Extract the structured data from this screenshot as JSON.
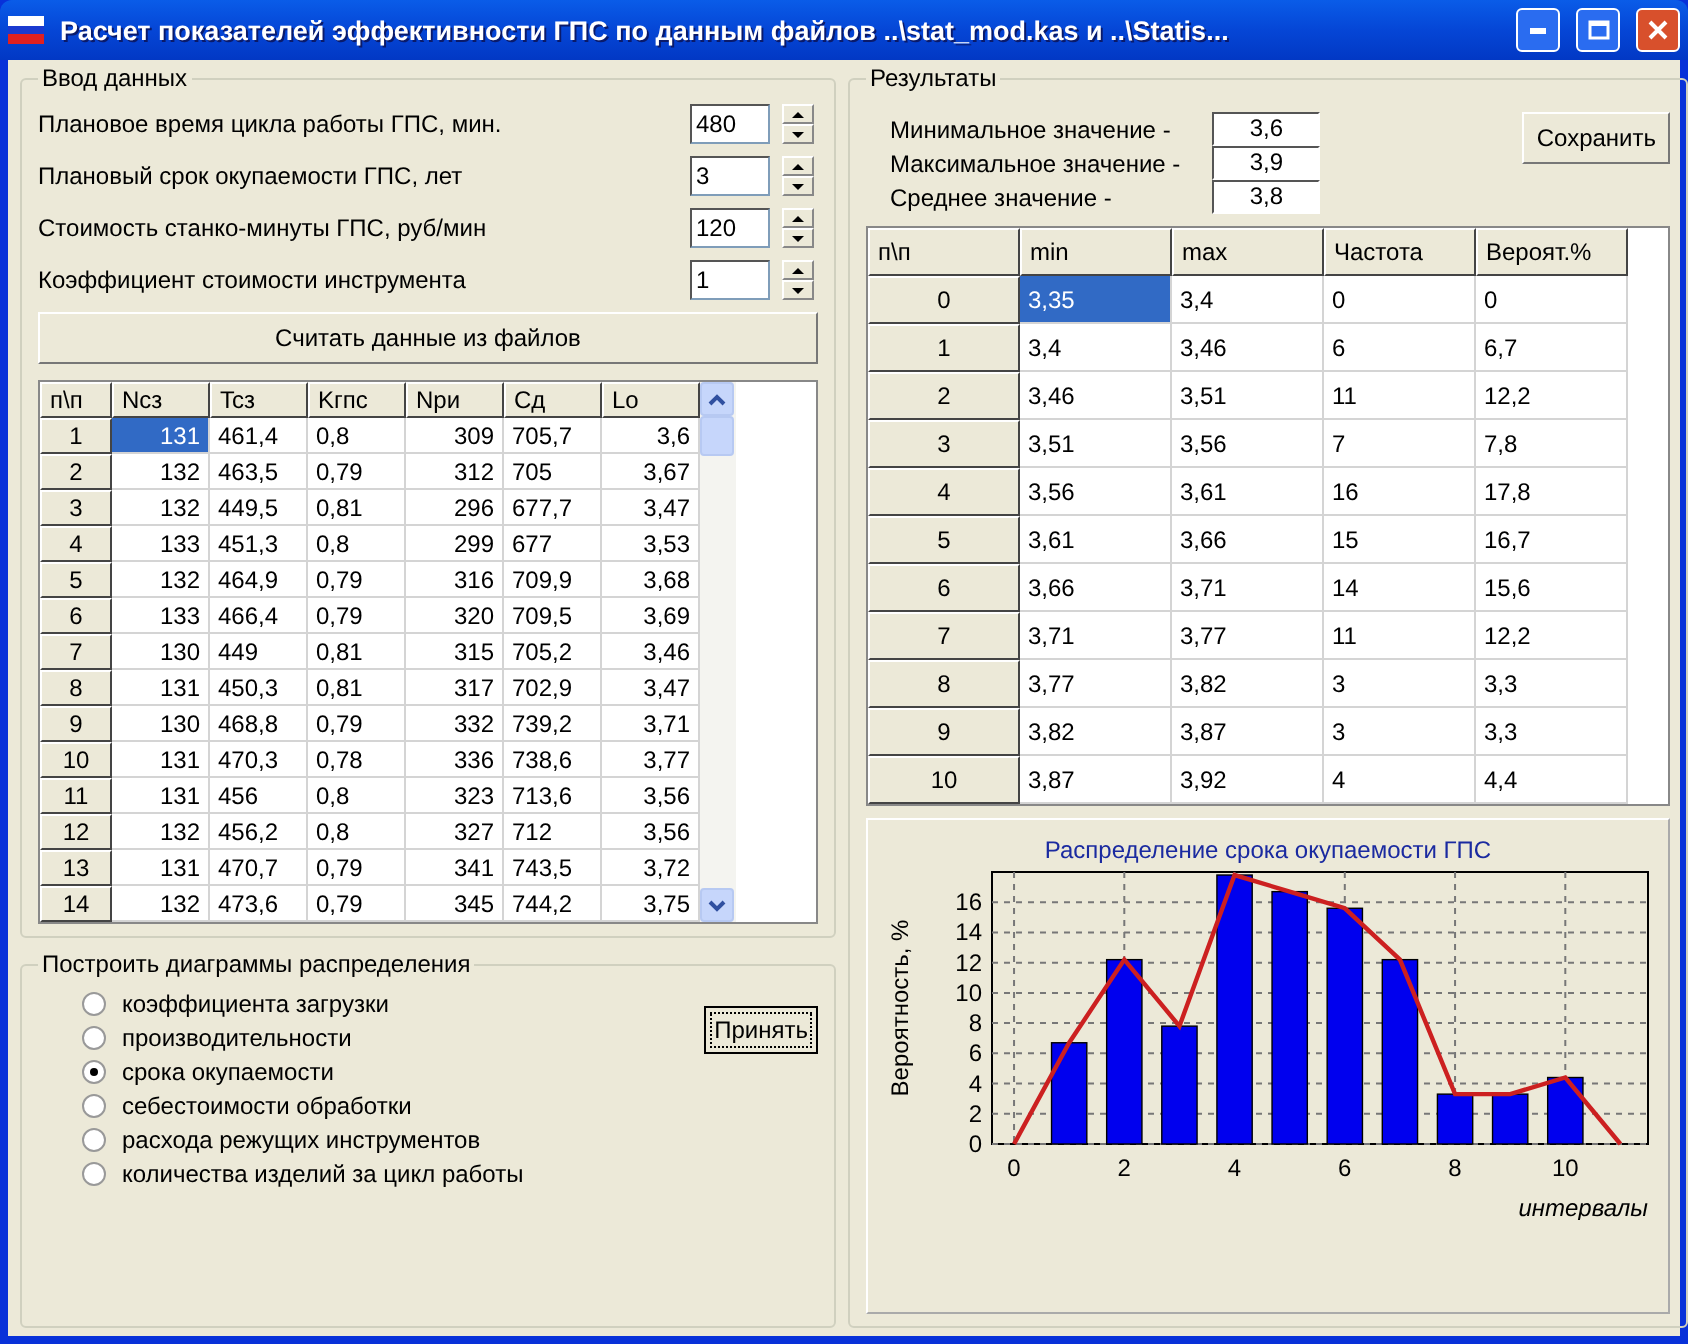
{
  "window": {
    "title": "Расчет показателей эффективности ГПС по данным файлов ..\\stat_mod.kas и ..\\Statis..."
  },
  "input_group": {
    "title": "Ввод данных",
    "fields": [
      {
        "label": "Плановое время цикла работы ГПС, мин.",
        "value": "480"
      },
      {
        "label": "Плановый срок окупаемости ГПС, лет",
        "value": "3"
      },
      {
        "label": "Стоимость станко-минуты ГПС, руб/мин",
        "value": "120"
      },
      {
        "label": "Коэффициент стоимости инструмента",
        "value": "1"
      }
    ],
    "read_button": "Считать данные из файлов",
    "table": {
      "columns": [
        "п\\п",
        "Ncз",
        "Tcз",
        "Kгпс",
        "Nри",
        "Cд",
        "Lo"
      ],
      "rows": [
        {
          "cells": [
            {
              "t": "1",
              "selected": false
            },
            {
              "t": "131",
              "selected": true
            },
            {
              "t": "461,4",
              "selected": false
            },
            {
              "t": "0,8",
              "selected": false
            },
            {
              "t": "309",
              "selected": false
            },
            {
              "t": "705,7",
              "selected": false
            },
            {
              "t": "3,6",
              "selected": false
            }
          ]
        },
        {
          "cells": [
            {
              "t": "2",
              "selected": false
            },
            {
              "t": "132",
              "selected": false
            },
            {
              "t": "463,5",
              "selected": false
            },
            {
              "t": "0,79",
              "selected": false
            },
            {
              "t": "312",
              "selected": false
            },
            {
              "t": "705",
              "selected": false
            },
            {
              "t": "3,67",
              "selected": false
            }
          ]
        },
        {
          "cells": [
            {
              "t": "3",
              "selected": false
            },
            {
              "t": "132",
              "selected": false
            },
            {
              "t": "449,5",
              "selected": false
            },
            {
              "t": "0,81",
              "selected": false
            },
            {
              "t": "296",
              "selected": false
            },
            {
              "t": "677,7",
              "selected": false
            },
            {
              "t": "3,47",
              "selected": false
            }
          ]
        },
        {
          "cells": [
            {
              "t": "4",
              "selected": false
            },
            {
              "t": "133",
              "selected": false
            },
            {
              "t": "451,3",
              "selected": false
            },
            {
              "t": "0,8",
              "selected": false
            },
            {
              "t": "299",
              "selected": false
            },
            {
              "t": "677",
              "selected": false
            },
            {
              "t": "3,53",
              "selected": false
            }
          ]
        },
        {
          "cells": [
            {
              "t": "5",
              "selected": false
            },
            {
              "t": "132",
              "selected": false
            },
            {
              "t": "464,9",
              "selected": false
            },
            {
              "t": "0,79",
              "selected": false
            },
            {
              "t": "316",
              "selected": false
            },
            {
              "t": "709,9",
              "selected": false
            },
            {
              "t": "3,68",
              "selected": false
            }
          ]
        },
        {
          "cells": [
            {
              "t": "6",
              "selected": false
            },
            {
              "t": "133",
              "selected": false
            },
            {
              "t": "466,4",
              "selected": false
            },
            {
              "t": "0,79",
              "selected": false
            },
            {
              "t": "320",
              "selected": false
            },
            {
              "t": "709,5",
              "selected": false
            },
            {
              "t": "3,69",
              "selected": false
            }
          ]
        },
        {
          "cells": [
            {
              "t": "7",
              "selected": false
            },
            {
              "t": "130",
              "selected": false
            },
            {
              "t": "449",
              "selected": false
            },
            {
              "t": "0,81",
              "selected": false
            },
            {
              "t": "315",
              "selected": false
            },
            {
              "t": "705,2",
              "selected": false
            },
            {
              "t": "3,46",
              "selected": false
            }
          ]
        },
        {
          "cells": [
            {
              "t": "8",
              "selected": false
            },
            {
              "t": "131",
              "selected": false
            },
            {
              "t": "450,3",
              "selected": false
            },
            {
              "t": "0,81",
              "selected": false
            },
            {
              "t": "317",
              "selected": false
            },
            {
              "t": "702,9",
              "selected": false
            },
            {
              "t": "3,47",
              "selected": false
            }
          ]
        },
        {
          "cells": [
            {
              "t": "9",
              "selected": false
            },
            {
              "t": "130",
              "selected": false
            },
            {
              "t": "468,8",
              "selected": false
            },
            {
              "t": "0,79",
              "selected": false
            },
            {
              "t": "332",
              "selected": false
            },
            {
              "t": "739,2",
              "selected": false
            },
            {
              "t": "3,71",
              "selected": false
            }
          ]
        },
        {
          "cells": [
            {
              "t": "10",
              "selected": false
            },
            {
              "t": "131",
              "selected": false
            },
            {
              "t": "470,3",
              "selected": false
            },
            {
              "t": "0,78",
              "selected": false
            },
            {
              "t": "336",
              "selected": false
            },
            {
              "t": "738,6",
              "selected": false
            },
            {
              "t": "3,77",
              "selected": false
            }
          ]
        },
        {
          "cells": [
            {
              "t": "11",
              "selected": false
            },
            {
              "t": "131",
              "selected": false
            },
            {
              "t": "456",
              "selected": false
            },
            {
              "t": "0,8",
              "selected": false
            },
            {
              "t": "323",
              "selected": false
            },
            {
              "t": "713,6",
              "selected": false
            },
            {
              "t": "3,56",
              "selected": false
            }
          ]
        },
        {
          "cells": [
            {
              "t": "12",
              "selected": false
            },
            {
              "t": "132",
              "selected": false
            },
            {
              "t": "456,2",
              "selected": false
            },
            {
              "t": "0,8",
              "selected": false
            },
            {
              "t": "327",
              "selected": false
            },
            {
              "t": "712",
              "selected": false
            },
            {
              "t": "3,56",
              "selected": false
            }
          ]
        },
        {
          "cells": [
            {
              "t": "13",
              "selected": false
            },
            {
              "t": "131",
              "selected": false
            },
            {
              "t": "470,7",
              "selected": false
            },
            {
              "t": "0,79",
              "selected": false
            },
            {
              "t": "341",
              "selected": false
            },
            {
              "t": "743,5",
              "selected": false
            },
            {
              "t": "3,72",
              "selected": false
            }
          ]
        },
        {
          "cells": [
            {
              "t": "14",
              "selected": false
            },
            {
              "t": "132",
              "selected": false
            },
            {
              "t": "473,6",
              "selected": false
            },
            {
              "t": "0,79",
              "selected": false
            },
            {
              "t": "345",
              "selected": false
            },
            {
              "t": "744,2",
              "selected": false
            },
            {
              "t": "3,75",
              "selected": false
            }
          ]
        }
      ]
    }
  },
  "diagram_group": {
    "title": "Построить диаграммы распределения",
    "options": [
      {
        "label": "коэффициента загрузки",
        "selected": false
      },
      {
        "label": "производительности",
        "selected": false
      },
      {
        "label": "срока окупаемости",
        "selected": true
      },
      {
        "label": "себестоимости обработки",
        "selected": false
      },
      {
        "label": "расхода режущих инструментов",
        "selected": false
      },
      {
        "label": "количества изделий за цикл работы",
        "selected": false
      }
    ],
    "apply_button": "Принять"
  },
  "results_group": {
    "title": "Результаты",
    "stats": [
      {
        "label": "Минимальное значение -",
        "value": "3,6"
      },
      {
        "label": "Максимальное значение -",
        "value": "3,9"
      },
      {
        "label": "Среднее значение -",
        "value": "3,8"
      }
    ],
    "save_button": "Сохранить",
    "table": {
      "columns": [
        "п\\п",
        "min",
        "max",
        "Частота",
        "Вероят.%"
      ],
      "rows": [
        {
          "cells": [
            {
              "t": "0",
              "selected": false
            },
            {
              "t": "3,35",
              "selected": true
            },
            {
              "t": "3,4",
              "selected": false
            },
            {
              "t": "0",
              "selected": false
            },
            {
              "t": "0",
              "selected": false
            }
          ]
        },
        {
          "cells": [
            {
              "t": "1",
              "selected": false
            },
            {
              "t": "3,4",
              "selected": false
            },
            {
              "t": "3,46",
              "selected": false
            },
            {
              "t": "6",
              "selected": false
            },
            {
              "t": "6,7",
              "selected": false
            }
          ]
        },
        {
          "cells": [
            {
              "t": "2",
              "selected": false
            },
            {
              "t": "3,46",
              "selected": false
            },
            {
              "t": "3,51",
              "selected": false
            },
            {
              "t": "11",
              "selected": false
            },
            {
              "t": "12,2",
              "selected": false
            }
          ]
        },
        {
          "cells": [
            {
              "t": "3",
              "selected": false
            },
            {
              "t": "3,51",
              "selected": false
            },
            {
              "t": "3,56",
              "selected": false
            },
            {
              "t": "7",
              "selected": false
            },
            {
              "t": "7,8",
              "selected": false
            }
          ]
        },
        {
          "cells": [
            {
              "t": "4",
              "selected": false
            },
            {
              "t": "3,56",
              "selected": false
            },
            {
              "t": "3,61",
              "selected": false
            },
            {
              "t": "16",
              "selected": false
            },
            {
              "t": "17,8",
              "selected": false
            }
          ]
        },
        {
          "cells": [
            {
              "t": "5",
              "selected": false
            },
            {
              "t": "3,61",
              "selected": false
            },
            {
              "t": "3,66",
              "selected": false
            },
            {
              "t": "15",
              "selected": false
            },
            {
              "t": "16,7",
              "selected": false
            }
          ]
        },
        {
          "cells": [
            {
              "t": "6",
              "selected": false
            },
            {
              "t": "3,66",
              "selected": false
            },
            {
              "t": "3,71",
              "selected": false
            },
            {
              "t": "14",
              "selected": false
            },
            {
              "t": "15,6",
              "selected": false
            }
          ]
        },
        {
          "cells": [
            {
              "t": "7",
              "selected": false
            },
            {
              "t": "3,71",
              "selected": false
            },
            {
              "t": "3,77",
              "selected": false
            },
            {
              "t": "11",
              "selected": false
            },
            {
              "t": "12,2",
              "selected": false
            }
          ]
        },
        {
          "cells": [
            {
              "t": "8",
              "selected": false
            },
            {
              "t": "3,77",
              "selected": false
            },
            {
              "t": "3,82",
              "selected": false
            },
            {
              "t": "3",
              "selected": false
            },
            {
              "t": "3,3",
              "selected": false
            }
          ]
        },
        {
          "cells": [
            {
              "t": "9",
              "selected": false
            },
            {
              "t": "3,82",
              "selected": false
            },
            {
              "t": "3,87",
              "selected": false
            },
            {
              "t": "3",
              "selected": false
            },
            {
              "t": "3,3",
              "selected": false
            }
          ]
        },
        {
          "cells": [
            {
              "t": "10",
              "selected": false
            },
            {
              "t": "3,87",
              "selected": false
            },
            {
              "t": "3,92",
              "selected": false
            },
            {
              "t": "4",
              "selected": false
            },
            {
              "t": "4,4",
              "selected": false
            }
          ]
        }
      ]
    },
    "chart_data": {
      "type": "bar",
      "title": "Распределение срока окупаемости ГПС",
      "xlabel": "интервалы",
      "ylabel": "Вероятность, %",
      "x": [
        0,
        1,
        2,
        3,
        4,
        5,
        6,
        7,
        8,
        9,
        10,
        11
      ],
      "series": [
        {
          "type": "bar",
          "color": "#0000ee",
          "values": [
            null,
            6.7,
            12.2,
            7.8,
            17.8,
            16.7,
            15.6,
            12.2,
            3.3,
            3.3,
            4.4,
            null
          ]
        },
        {
          "type": "line",
          "color": "#cc2020",
          "values": [
            0,
            6.7,
            12.2,
            7.8,
            17.8,
            16.7,
            15.6,
            12.2,
            3.3,
            3.3,
            4.4,
            0
          ]
        }
      ],
      "grid": true,
      "xlim": [
        -0.4,
        11.5
      ],
      "ylim": [
        0,
        18
      ],
      "xticks": [
        0,
        2,
        4,
        6,
        8,
        10
      ],
      "yticks": [
        0,
        2,
        4,
        6,
        8,
        10,
        12,
        14,
        16
      ]
    }
  }
}
